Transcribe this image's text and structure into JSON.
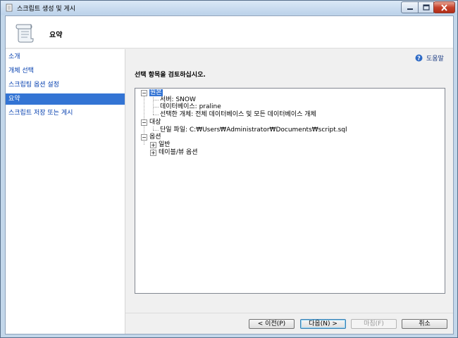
{
  "window": {
    "title": "스크립트 생성 및 게시"
  },
  "header": {
    "title": "요약"
  },
  "sidebar": {
    "items": [
      {
        "label": "소개",
        "active": false
      },
      {
        "label": "개체 선택",
        "active": false
      },
      {
        "label": "스크립팅 옵션 설정",
        "active": false
      },
      {
        "label": "요약",
        "active": true
      },
      {
        "label": "스크립트 저장 또는 게시",
        "active": false
      }
    ]
  },
  "main": {
    "help_label": "도움말",
    "instruction": "선택 항목을 검토하십시오."
  },
  "tree": {
    "source": {
      "label": "원본",
      "children": [
        "서버: SNOW",
        "데이터베이스: praline",
        "선택한 개체: 전체 데이터베이스 및 모든 데이터베이스 개체"
      ]
    },
    "target": {
      "label": "대상",
      "children": [
        "단일 파일: C:₩Users₩Administrator₩Documents₩script.sql"
      ]
    },
    "options": {
      "label": "옵션",
      "children": [
        "일반",
        "테이블/뷰 옵션"
      ]
    }
  },
  "buttons": {
    "prev": "< 이전(P)",
    "next": "다음(N) >",
    "finish": "마침(F)",
    "cancel": "취소"
  },
  "icons": {
    "title": "scroll-icon",
    "header": "scroll-icon",
    "help": "help-icon"
  },
  "colors": {
    "accent": "#3374d4",
    "link": "#003cae"
  }
}
